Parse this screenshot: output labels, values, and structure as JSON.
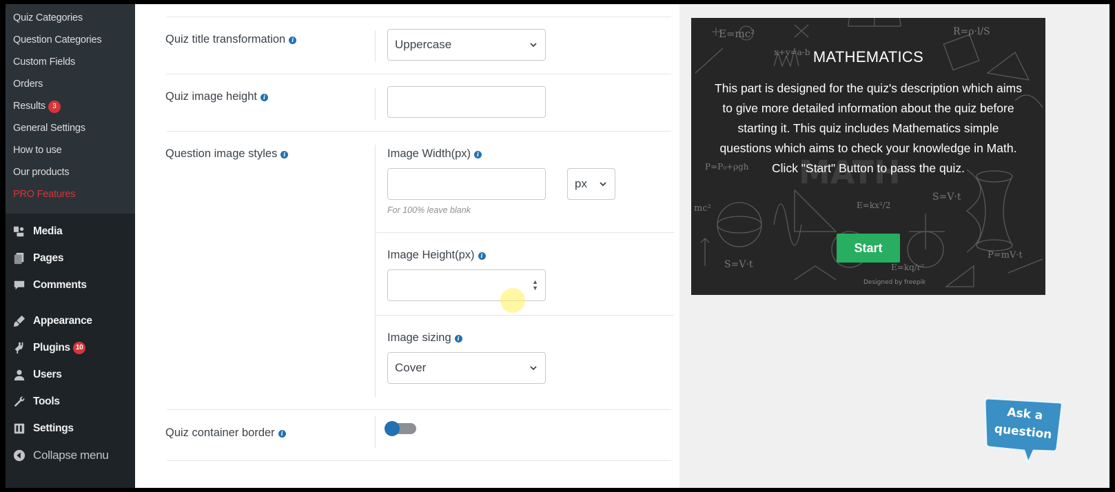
{
  "sidebar": {
    "submenu": [
      {
        "label": "Quiz Categories"
      },
      {
        "label": "Question Categories"
      },
      {
        "label": "Custom Fields"
      },
      {
        "label": "Orders"
      },
      {
        "label": "Results",
        "badge": "3"
      },
      {
        "label": "General Settings"
      },
      {
        "label": "How to use"
      },
      {
        "label": "Our products"
      },
      {
        "label": "PRO Features"
      }
    ],
    "menu": [
      {
        "label": "Media",
        "icon": "media-icon"
      },
      {
        "label": "Pages",
        "icon": "pages-icon"
      },
      {
        "label": "Comments",
        "icon": "comments-icon"
      },
      {
        "label": "Appearance",
        "icon": "appearance-icon"
      },
      {
        "label": "Plugins",
        "icon": "plugins-icon",
        "badge": "10"
      },
      {
        "label": "Users",
        "icon": "users-icon"
      },
      {
        "label": "Tools",
        "icon": "tools-icon"
      },
      {
        "label": "Settings",
        "icon": "settings-icon"
      }
    ],
    "collapse_label": "Collapse menu"
  },
  "form": {
    "title_transform": {
      "label": "Quiz title transformation",
      "value": "Uppercase"
    },
    "image_height": {
      "label": "Quiz image height",
      "value": ""
    },
    "question_image_styles": {
      "label": "Question image styles",
      "width_label": "Image Width(px)",
      "width_value": "",
      "unit_value": "px",
      "width_hint": "For 100% leave blank",
      "height_label": "Image Height(px)",
      "height_value": "",
      "sizing_label": "Image sizing",
      "sizing_value": "Cover"
    },
    "container_border": {
      "label": "Quiz container border",
      "enabled": false
    }
  },
  "preview": {
    "title": "MATHEMATICS",
    "description": "This part is designed for the quiz's description which aims to give more detailed information about the quiz before starting it. This quiz includes Mathematics simple questions which aims to check your knowledge in Math. Click \"Start\" Button to pass the quiz.",
    "start_label": "Start",
    "start_color": "#27ae60",
    "background_color": "#262626"
  },
  "ask": {
    "line1": "Ask a",
    "line2": "question",
    "color": "#3a8fc4"
  },
  "colors": {
    "sidebar": "#1d2327",
    "submenu": "#2c3338",
    "accent": "#2271b1",
    "badge": "#d63638"
  }
}
